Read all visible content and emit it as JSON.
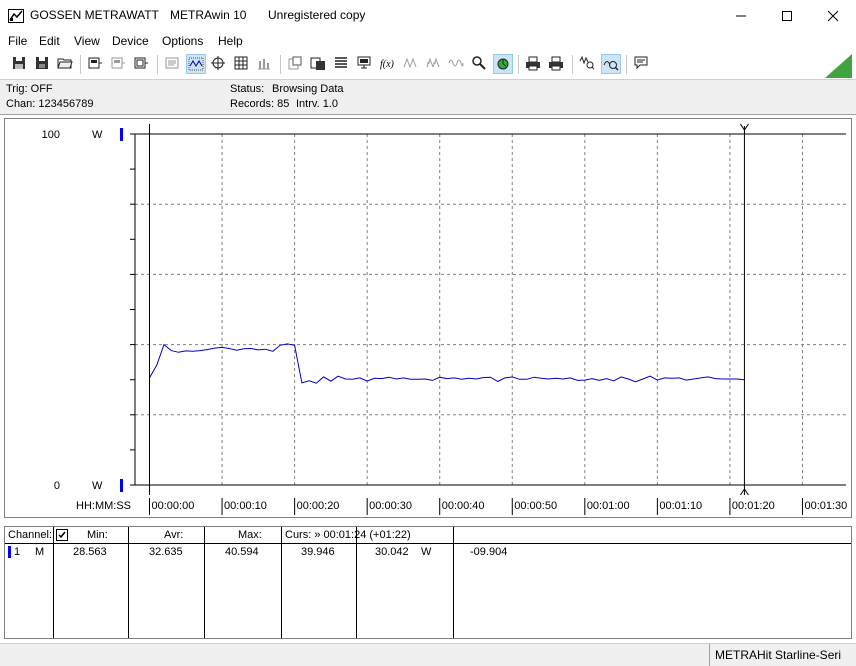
{
  "window": {
    "vendor": "GOSSEN METRAWATT",
    "app": "METRAwin 10",
    "license": "Unregistered copy",
    "minimize_icon": "minimize-icon",
    "maximize_icon": "maximize-icon",
    "close_icon": "close-icon"
  },
  "menu": {
    "items": [
      "File",
      "Edit",
      "View",
      "Device",
      "Options",
      "Help"
    ]
  },
  "status": {
    "trig": "Trig: OFF",
    "chan": "Chan:  123456789",
    "status_label": "Status:",
    "status_value": "Browsing Data",
    "records_label": "Records: 85",
    "interval_label": "Intrv. 1.0"
  },
  "chart": {
    "y_top": "100",
    "y_bottom": "0",
    "unit_top": "W",
    "unit_bottom": "W",
    "time_label": "HH:MM:SS",
    "time_ticks": [
      "00:00:00",
      "00:00:10",
      "00:00:20",
      "00:00:30",
      "00:00:40",
      "00:00:50",
      "00:01:00",
      "00:01:10",
      "00:01:20",
      "00:01:30"
    ]
  },
  "chart_data": {
    "type": "line",
    "title": "",
    "xlabel": "HH:MM:SS",
    "ylabel": "W",
    "ylim": [
      0,
      100
    ],
    "xlim": [
      -2,
      96
    ],
    "grid": true,
    "cursor_left_x": 0,
    "cursor_right_x": 82,
    "x": [
      0,
      1,
      2,
      3,
      4,
      5,
      6,
      7,
      8,
      9,
      10,
      11,
      12,
      13,
      14,
      15,
      16,
      17,
      18,
      19,
      20,
      21,
      22,
      23,
      24,
      25,
      26,
      27,
      28,
      29,
      30,
      31,
      32,
      33,
      34,
      35,
      36,
      37,
      38,
      39,
      40,
      41,
      42,
      43,
      44,
      45,
      46,
      47,
      48,
      49,
      50,
      51,
      52,
      53,
      54,
      55,
      56,
      57,
      58,
      59,
      60,
      61,
      62,
      63,
      64,
      65,
      66,
      67,
      68,
      69,
      70,
      71,
      72,
      73,
      74,
      75,
      76,
      77,
      78,
      79,
      80,
      81,
      82
    ],
    "series": [
      {
        "values": [
          30.5,
          34.2,
          40.0,
          38.3,
          37.8,
          38.2,
          38.1,
          38.3,
          38.6,
          39.0,
          39.2,
          38.9,
          38.4,
          38.8,
          38.9,
          38.5,
          38.7,
          38.1,
          39.8,
          40.2,
          39.8,
          29.1,
          29.7,
          29.0,
          30.8,
          29.6,
          31.0,
          30.2,
          30.1,
          30.5,
          29.6,
          30.4,
          30.3,
          30.7,
          30.2,
          30.5,
          30.1,
          30.1,
          30.2,
          29.8,
          30.7,
          30.3,
          30.5,
          30.1,
          30.4,
          30.2,
          30.6,
          30.7,
          29.5,
          30.5,
          30.8,
          30.1,
          30.1,
          30.7,
          30.4,
          30.2,
          30.4,
          30.2,
          30.5,
          29.8,
          29.9,
          30.3,
          29.8,
          30.3,
          29.7,
          30.8,
          30.2,
          29.4,
          30.2,
          31.0,
          29.9,
          30.5,
          30.4,
          30.5,
          29.9,
          30.2,
          30.5,
          30.8,
          30.3,
          30.2,
          30.2,
          30.2,
          30.0
        ]
      }
    ]
  },
  "table": {
    "headers": {
      "channel": "Channel:",
      "min": "Min:",
      "avr": "Avr:",
      "max": "Max:",
      "curs": "Curs: » 00:01:24 (+01:22)"
    },
    "row": {
      "channel_no": "1",
      "mode": "M",
      "min": "28.563",
      "avr": "32.635",
      "max": "40.594",
      "curs1": "39.946",
      "curs2": "30.042",
      "unit": "W",
      "delta": "-09.904"
    }
  },
  "statusbar": {
    "device": "METRAHit Starline-Seri"
  },
  "colors": {
    "trace": "#0000c8",
    "marker_blue": "#0000ff",
    "cursor_line": "#000000",
    "grid": "#808080",
    "corner_green": "#3ea53e"
  }
}
